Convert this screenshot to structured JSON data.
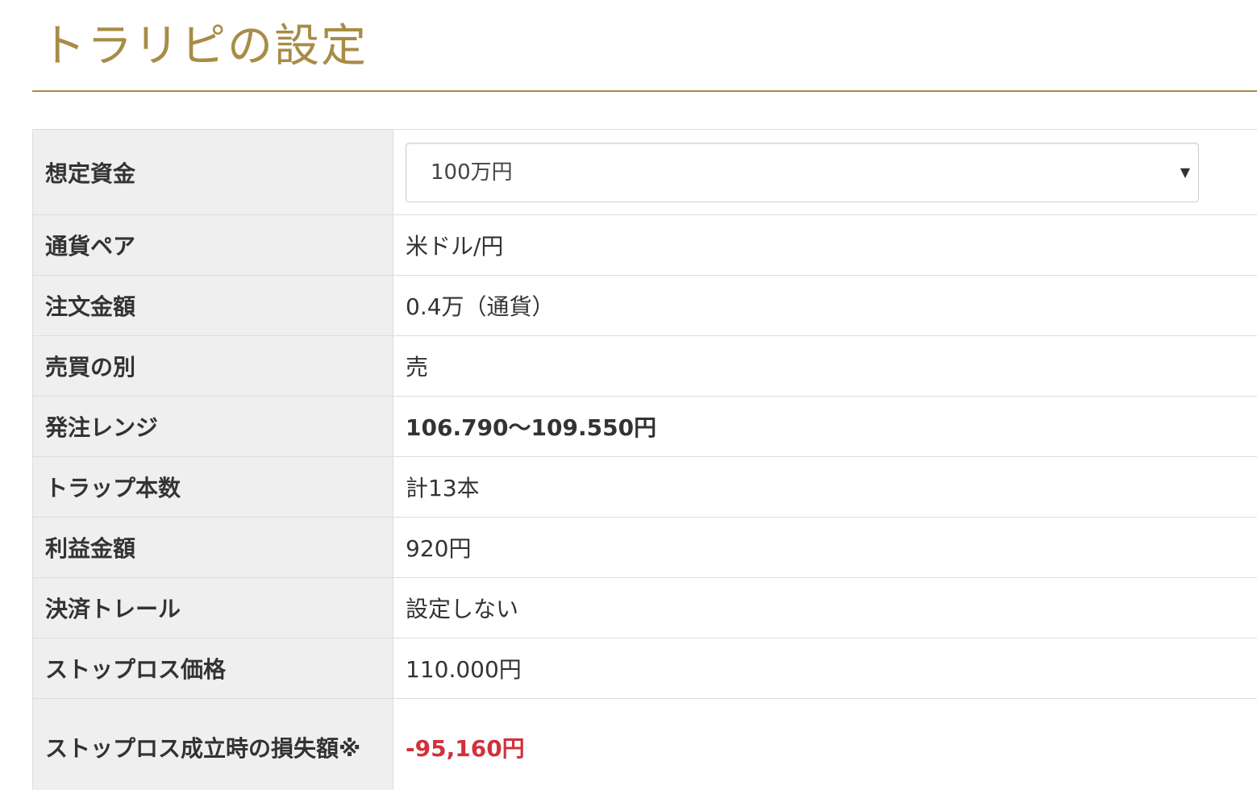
{
  "page": {
    "title": "トラリピの設定"
  },
  "select": {
    "value": "100万円",
    "icon": "chevron-down-icon"
  },
  "rows": [
    {
      "label": "想定資金",
      "value": "100万円"
    },
    {
      "label": "通貨ペア",
      "value": "米ドル/円"
    },
    {
      "label": "注文金額",
      "value": "0.4万（通貨）"
    },
    {
      "label": "売買の別",
      "value": "売"
    },
    {
      "label": "発注レンジ",
      "value": "106.790～109.550円"
    },
    {
      "label": "トラップ本数",
      "value": "計13本"
    },
    {
      "label": "利益金額",
      "value": "920円"
    },
    {
      "label": "決済トレール",
      "value": "設定しない"
    },
    {
      "label": "ストップロス価格",
      "value": "110.000円"
    },
    {
      "label": "ストップロス成立時の損失額※",
      "value": "-95,160円"
    }
  ],
  "colors": {
    "accent": "#a88c46",
    "label_bg": "#efefef",
    "loss": "#d0313b",
    "border": "#dddddd"
  }
}
